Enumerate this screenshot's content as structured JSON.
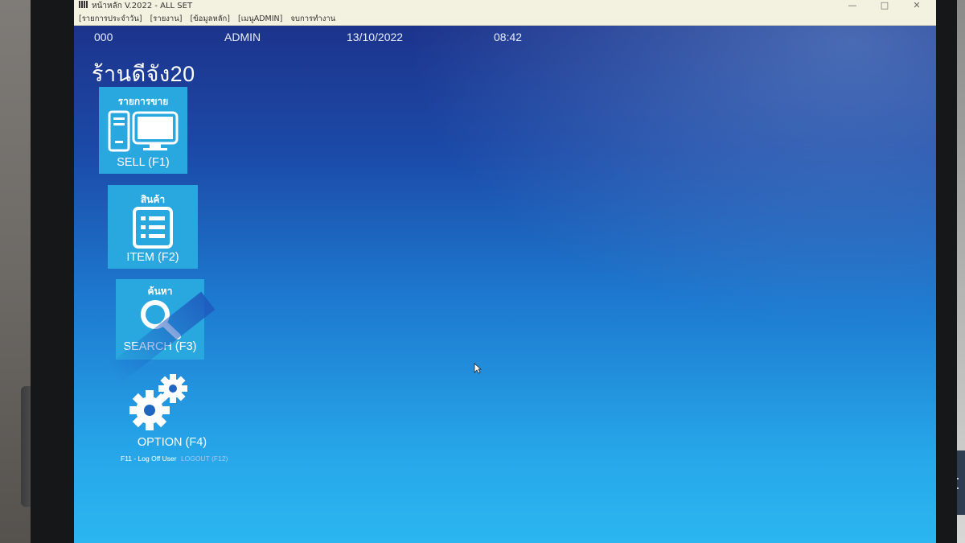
{
  "window": {
    "title": "หน้าหลัก V.2022 - ALL SET",
    "menu": [
      "[รายการประจำวัน]",
      "[รายงาน]",
      "[ข้อมูลหลัก]",
      "[เมนูADMIN]",
      "จบการทำงาน"
    ]
  },
  "infobar": {
    "code": "000",
    "user": "ADMIN",
    "date": "13/10/2022",
    "time": "08:42"
  },
  "shop_name": "ร้านดีจัง20",
  "tiles": {
    "sell": {
      "thai": "รายการขาย",
      "label": "SELL (F1)",
      "icon": "pos-terminal-icon"
    },
    "item": {
      "thai": "สินค้า",
      "label": "ITEM (F2)",
      "icon": "list-icon"
    },
    "search": {
      "thai": "ค้นหา",
      "label": "SEARCH (F3)",
      "icon": "search-icon"
    },
    "option": {
      "label": "OPTION (F4)",
      "icon": "gears-icon"
    }
  },
  "shortcuts": {
    "logoff": "F11 - Log Off User",
    "logout": "LOGOUT (F12)"
  },
  "colors": {
    "tile": "#29a8e0",
    "desktop_top": "#1d2f86",
    "desktop_bottom": "#2bb6f0",
    "titlebar": "#f3f1df"
  }
}
